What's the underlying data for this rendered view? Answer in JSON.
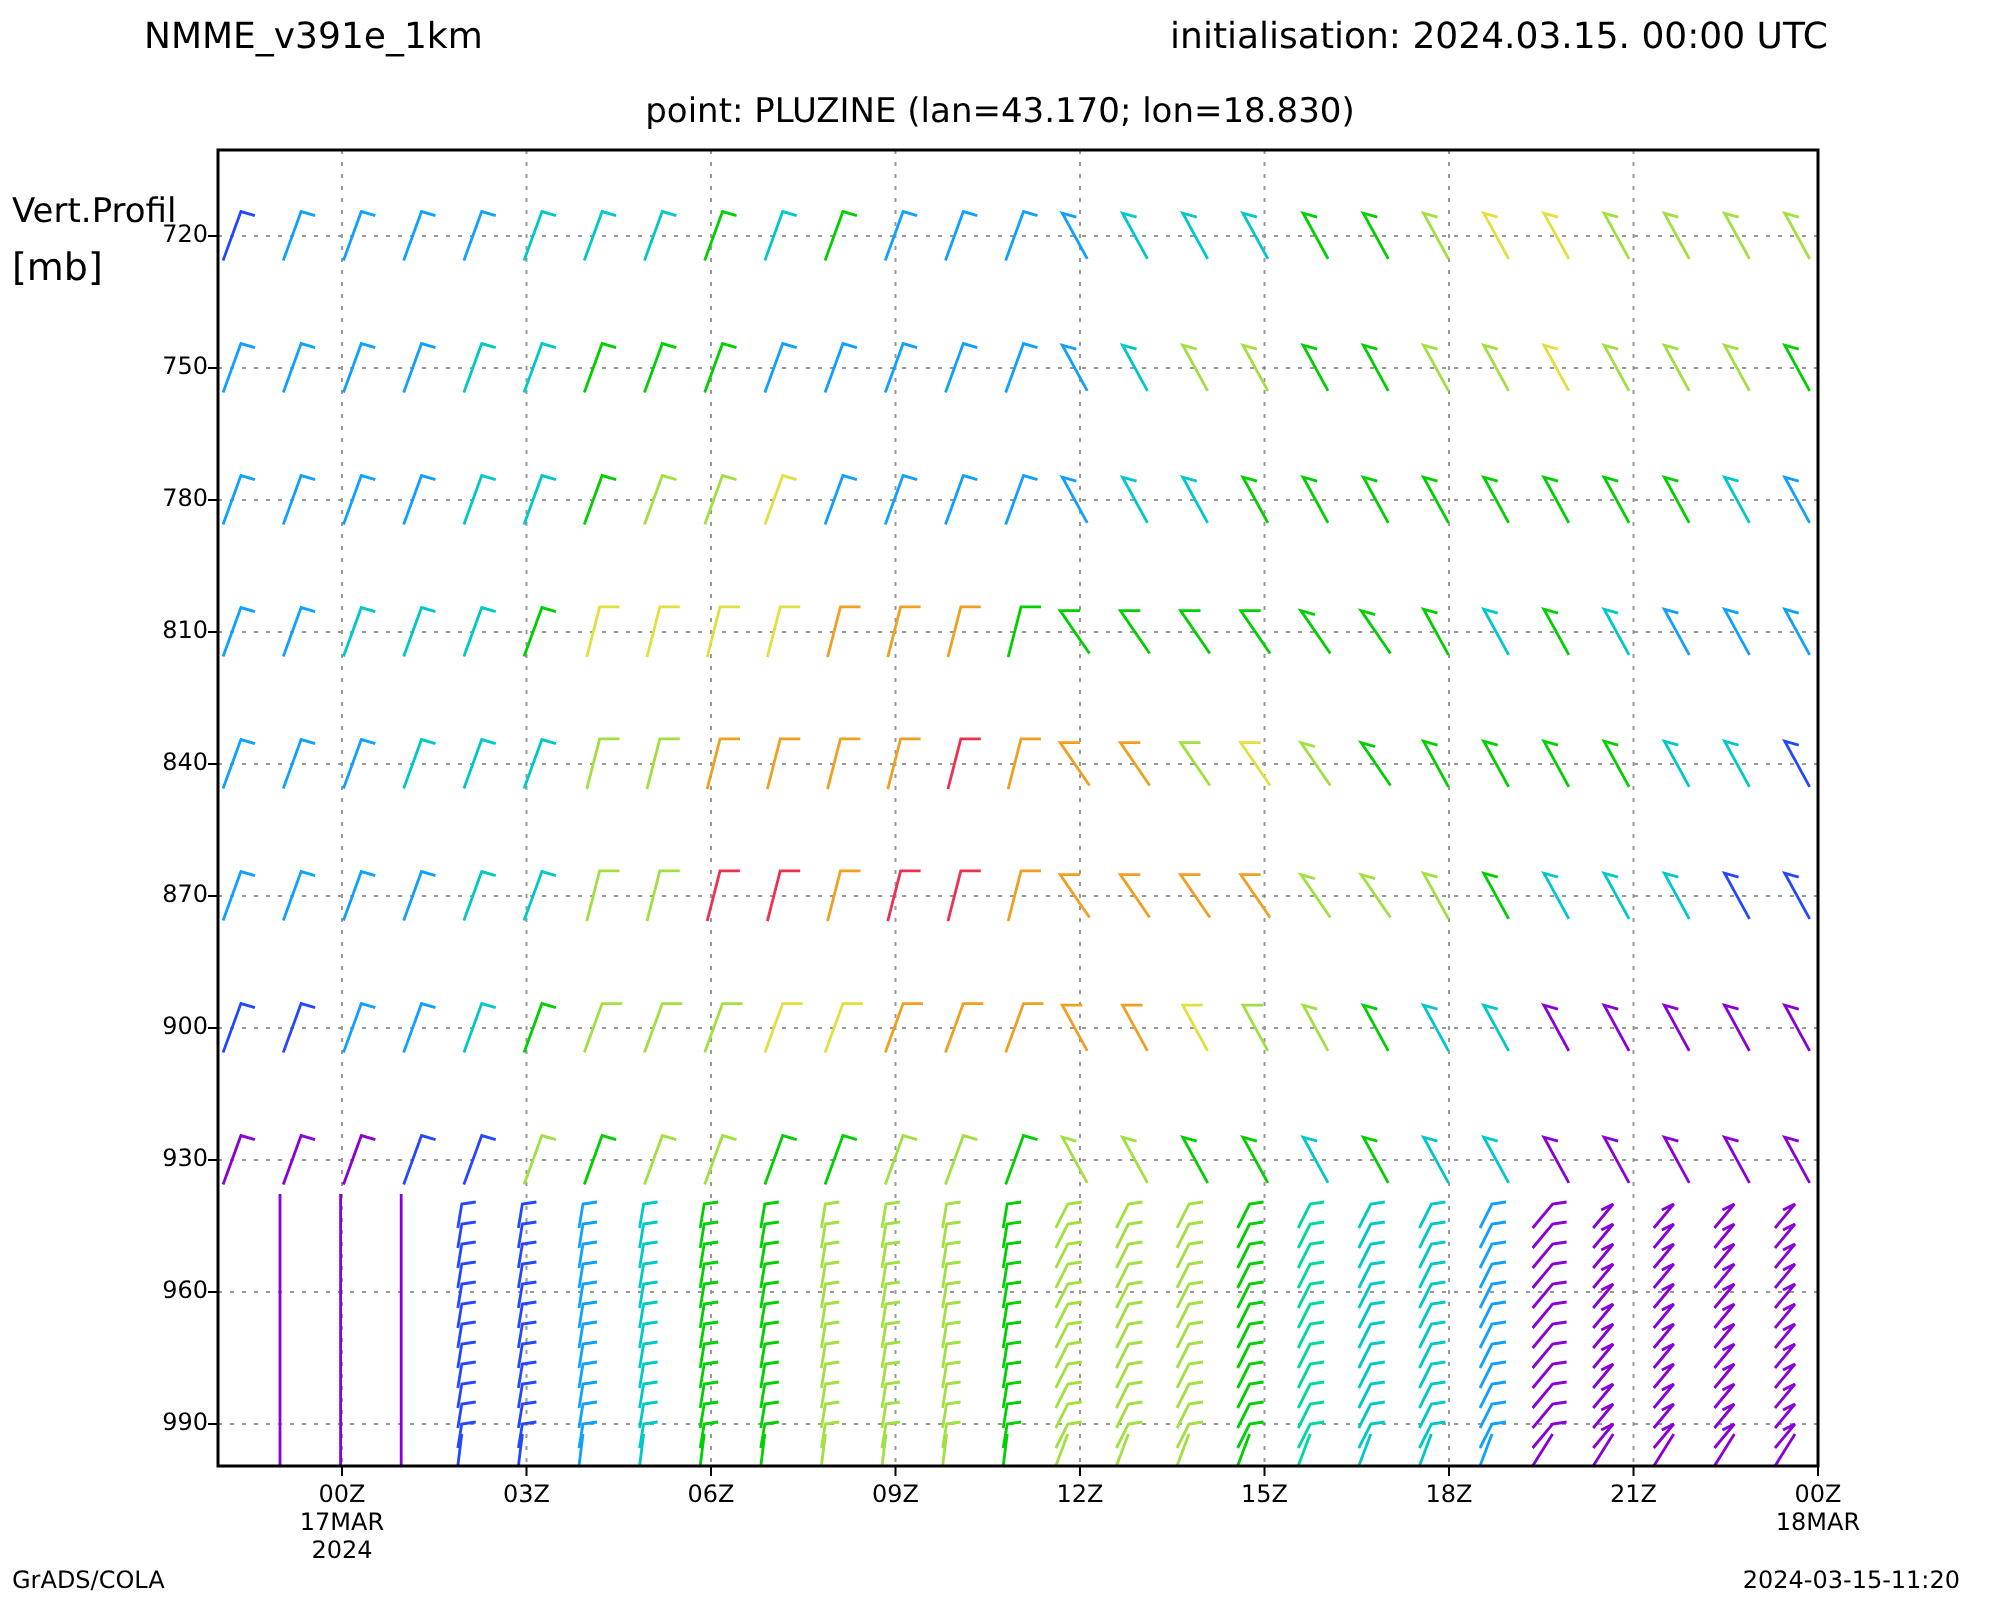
{
  "header": {
    "model": "NMME_v391e_1km",
    "initialisation": "initialisation: 2024.03.15. 00:00 UTC",
    "point": "point: PLUZINE (lan=43.170; lon=18.830)"
  },
  "y_axis": {
    "title_lines": [
      "Vert.Profil",
      "[mb]"
    ],
    "tick_labels": [
      "720",
      "750",
      "780",
      "810",
      "840",
      "870",
      "900",
      "930",
      "960",
      "990"
    ]
  },
  "x_axis": {
    "tick_labels": [
      [
        "00Z",
        "17MAR",
        "2024"
      ],
      [
        "03Z"
      ],
      [
        "06Z"
      ],
      [
        "09Z"
      ],
      [
        "12Z"
      ],
      [
        "15Z"
      ],
      [
        "18Z"
      ],
      [
        "21Z"
      ],
      [
        "00Z",
        "18MAR"
      ]
    ]
  },
  "footer": {
    "left": "GrADS/COLA",
    "right": "2024-03-15-11:20"
  }
}
